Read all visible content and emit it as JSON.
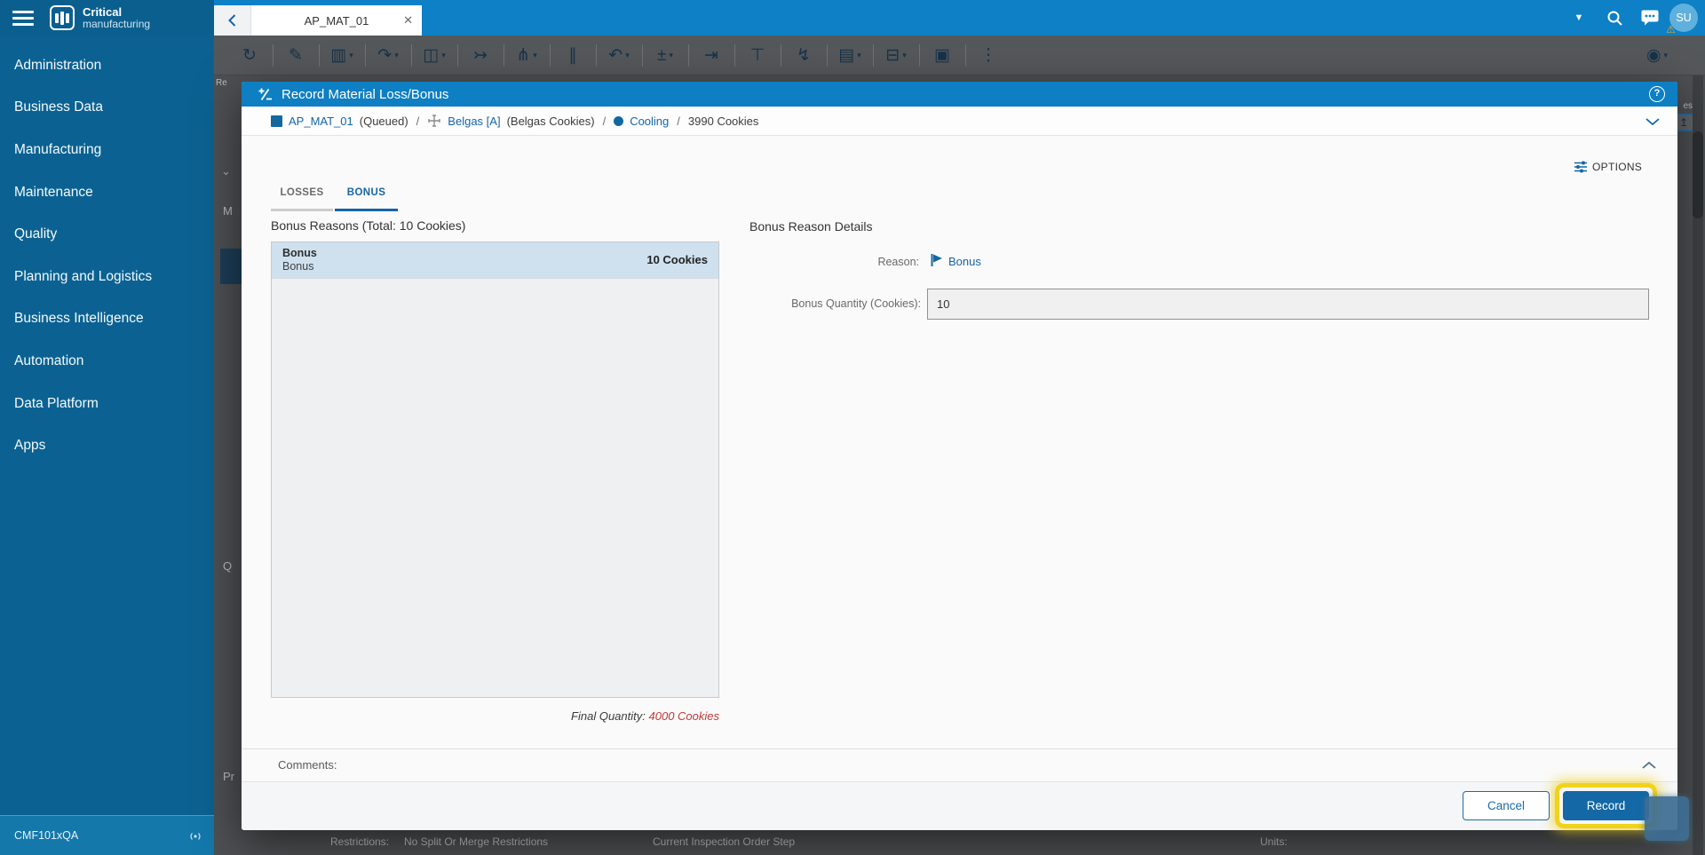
{
  "colors": {
    "topbar_blue": "#0d80c6",
    "sidebar_blue": "#0b6292",
    "modal_header_blue": "#0e7fc3",
    "link_blue": "#1565a8",
    "primary_button_blue": "#1368a5",
    "selected_row_blue": "#cfe1ef",
    "highlight_yellow": "#f1d21c",
    "final_quantity_red": "#c23a3a"
  },
  "topbar": {
    "logo_primary": "Critical",
    "logo_secondary": "manufacturing",
    "tab_label": "AP_MAT_01",
    "avatar_initials": "SU"
  },
  "sidebar": {
    "items": [
      "Administration",
      "Business Data",
      "Manufacturing",
      "Maintenance",
      "Quality",
      "Planning and Logistics",
      "Business Intelligence",
      "Automation",
      "Data Platform",
      "Apps"
    ],
    "environment": "CMF101xQA"
  },
  "background": {
    "toolbar_icons": [
      {
        "name": "refresh",
        "glyph": "↻",
        "caret": false
      },
      {
        "name": "edit",
        "glyph": "✎",
        "caret": false
      },
      {
        "name": "reports",
        "glyph": "▥",
        "caret": true
      },
      {
        "name": "redo",
        "glyph": "↷",
        "caret": true
      },
      {
        "name": "split",
        "glyph": "◫",
        "caret": true
      },
      {
        "name": "merge",
        "glyph": "↣",
        "caret": false
      },
      {
        "name": "route",
        "glyph": "⋔",
        "caret": true
      },
      {
        "name": "hold",
        "glyph": "∥",
        "caret": false
      },
      {
        "name": "undo",
        "glyph": "↶",
        "caret": true
      },
      {
        "name": "loss-bonus",
        "glyph": "±",
        "caret": true
      },
      {
        "name": "move-out",
        "glyph": "⇥",
        "caret": false
      },
      {
        "name": "container",
        "glyph": "⊤",
        "caret": false
      },
      {
        "name": "run",
        "glyph": "↯",
        "caret": false
      },
      {
        "name": "document",
        "glyph": "▤",
        "caret": true
      },
      {
        "name": "print",
        "glyph": "⊟",
        "caret": true
      },
      {
        "name": "logbook",
        "glyph": "▣",
        "caret": false
      },
      {
        "name": "more",
        "glyph": "⋮",
        "caret": false
      }
    ],
    "toolbar_label_fragment": "Re",
    "right_fragment": "es",
    "left_fragments": [
      "M",
      "Q",
      "Pr"
    ],
    "bottom_strip": {
      "restrictions_label": "Restrictions:",
      "restrictions_value": "No Split Or Merge Restrictions",
      "inspection_step_label": "Current Inspection Order Step",
      "units_label": "Units:"
    }
  },
  "modal": {
    "title": "Record Material Loss/Bonus",
    "breadcrumb": {
      "material": "AP_MAT_01",
      "material_state": "(Queued)",
      "product": "Belgas [A]",
      "product_desc": "(Belgas Cookies)",
      "step": "Cooling",
      "quantity": "3990 Cookies",
      "separator": "/"
    },
    "options_label": "OPTIONS",
    "tabs": {
      "losses": "LOSSES",
      "bonus": "BONUS"
    },
    "list_header": "Bonus Reasons (Total: 10 Cookies)",
    "list_item": {
      "title": "Bonus",
      "subtitle": "Bonus",
      "quantity": "10 Cookies"
    },
    "final_quantity_label": "Final Quantity:",
    "final_quantity_value": "4000 Cookies",
    "details": {
      "heading": "Bonus Reason Details",
      "reason_label": "Reason:",
      "reason_value": "Bonus",
      "quantity_label": "Bonus Quantity (Cookies):",
      "quantity_value": "10"
    },
    "comments_label": "Comments:",
    "buttons": {
      "cancel": "Cancel",
      "record": "Record"
    }
  }
}
